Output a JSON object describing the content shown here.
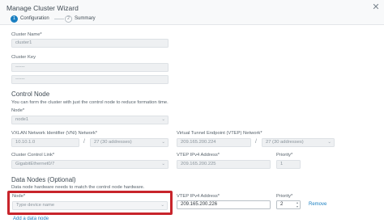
{
  "window": {
    "title": "Manage Cluster Wizard"
  },
  "steps": [
    {
      "num": "1",
      "label": "Configuration"
    },
    {
      "num": "2",
      "label": "Summary"
    }
  ],
  "cluster": {
    "name_label": "Cluster Name*",
    "name_value": "cluster1",
    "key_label": "Cluster Key",
    "key_value": "------"
  },
  "control_node": {
    "heading": "Control Node",
    "desc": "You can form the cluster with just the control node to reduce formation time.",
    "node_label": "Node*",
    "node_value": "node1",
    "vni_label": "VXLAN Network Identifier (VNI) Network*",
    "vni_ip": "10.10.1.0",
    "vni_prefix": "27 (30 addresses)",
    "vtep_label": "Virtual Tunnel Endpoint (VTEP) Network*",
    "vtep_ip": "209.165.200.224",
    "vtep_prefix": "27 (30 addresses)",
    "ccl_label": "Cluster Control Link*",
    "ccl_value": "GigabitEthernet0/7",
    "vtep_ipv4_label": "VTEP IPv4 Address*",
    "vtep_ipv4_value": "209.165.200.225",
    "priority_label": "Priority*",
    "priority_value": "1",
    "slash": "/"
  },
  "data_nodes": {
    "heading": "Data Nodes (Optional)",
    "desc": "Data node hardware needs to match the control node hardware.",
    "node_label": "Node*",
    "node_placeholder": "Type device name",
    "vtep_ipv4_label": "VTEP IPv4 Address*",
    "vtep_ipv4_value": "209.165.200.226",
    "priority_label": "Priority*",
    "priority_value": "2",
    "remove_label": "Remove",
    "add_label": "Add a data node"
  },
  "colors": {
    "accent": "#1a7fc1",
    "highlight": "#c8242b"
  },
  "icons": {
    "close": "close-icon",
    "dropdown": "chevron-down-icon",
    "spinner": "spinner-arrows-icon"
  }
}
